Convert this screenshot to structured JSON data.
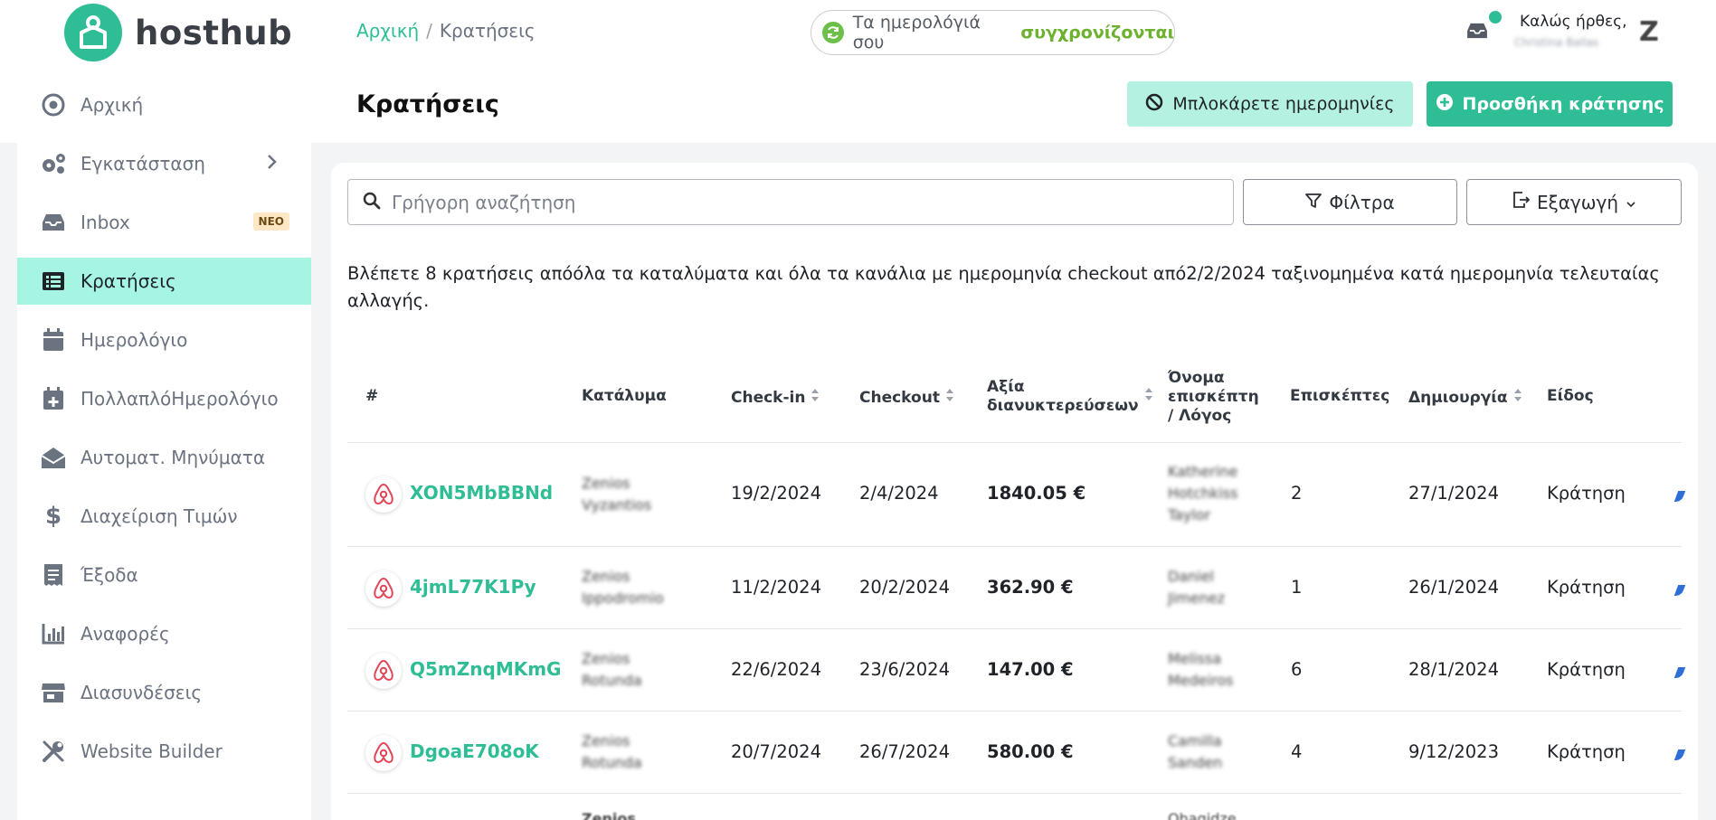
{
  "app": {
    "name": "hosthub"
  },
  "sidebar": {
    "items": [
      {
        "label": "Αρχική",
        "icon": "target-icon"
      },
      {
        "label": "Εγκατάσταση",
        "icon": "gears-icon"
      },
      {
        "label": "Inbox",
        "icon": "inbox-icon",
        "badge": "ΝΕΟ"
      },
      {
        "label": "Κρατήσεις",
        "icon": "list-icon",
        "active": true
      },
      {
        "label": "Ημερολόγιο",
        "icon": "calendar-icon"
      },
      {
        "label": "ΠολλαπλόΗμερολόγιο",
        "icon": "calendar-plus-icon"
      },
      {
        "label": "Αυτοματ. Μηνύματα",
        "icon": "envelope-open-icon"
      },
      {
        "label": "Διαχείριση Τιμών",
        "icon": "dollar-icon"
      },
      {
        "label": "Έξοδα",
        "icon": "receipt-icon"
      },
      {
        "label": "Αναφορές",
        "icon": "bar-chart-icon"
      },
      {
        "label": "Διασυνδέσεις",
        "icon": "store-icon"
      },
      {
        "label": "Website Builder",
        "icon": "tools-icon"
      }
    ]
  },
  "header": {
    "breadcrumb": {
      "home": "Αρχική",
      "separator": "/",
      "current": "Κρατήσεις"
    },
    "sync": {
      "text": "Τα ημερολόγιά σου",
      "strong": "συγχρονίζονται"
    },
    "user": {
      "greeting": "Καλώς ήρθες,",
      "name": "Christina Ballas"
    }
  },
  "page": {
    "title": "Κρατήσεις",
    "block_label": "Μπλοκάρετε ημερομηνίες",
    "add_label": "Προσθήκη κράτησης"
  },
  "toolbar": {
    "search_placeholder": "Γρήγορη αναζήτηση",
    "filter_label": "Φίλτρα",
    "export_label": "Εξαγωγή"
  },
  "summary": "Βλέπετε 8 κρατήσεις απόόλα τα καταλύματα και όλα τα κανάλια με ημερομηνία checkout από2/2/2024 ταξινομημένα κατά ημερομηνία τελευταίας αλλαγής.",
  "table": {
    "headers": {
      "num": "#",
      "property": "Κατάλυμα",
      "checkin": "Check-in",
      "checkout": "Checkout",
      "value_1": "Αξία",
      "value_2": "διανυκτερεύσεων",
      "guest_1": "Όνομα",
      "guest_2": "επισκέπτη",
      "guest_3": "/ Λόγος",
      "guests": "Επισκέπτες",
      "created": "Δημιουργία",
      "type": "Είδος"
    },
    "rows": [
      {
        "code": "XON5MbBBNd",
        "property": "Zenios Vyzantios",
        "checkin": "19/2/2024",
        "checkout": "2/4/2024",
        "value": "1840.05 €",
        "guest": "Katherine Hotchkiss Taylor",
        "guests": "2",
        "created": "27/1/2024",
        "type": "Κράτηση"
      },
      {
        "code": "4jmL77K1Py",
        "property": "Zenios Ippodromio",
        "checkin": "11/2/2024",
        "checkout": "20/2/2024",
        "value": "362.90 €",
        "guest": "Daniel Jimenez",
        "guests": "1",
        "created": "26/1/2024",
        "type": "Κράτηση"
      },
      {
        "code": "Q5mZnqMKmG",
        "property": "Zenios Rotunda",
        "checkin": "22/6/2024",
        "checkout": "23/6/2024",
        "value": "147.00 €",
        "guest": "Melissa Medeiros",
        "guests": "6",
        "created": "28/1/2024",
        "type": "Κράτηση"
      },
      {
        "code": "DgoaE708oK",
        "property": "Zenios Rotunda",
        "checkin": "20/7/2024",
        "checkout": "26/7/2024",
        "value": "580.00 €",
        "guest": "Camilla Sanden",
        "guests": "4",
        "created": "9/12/2023",
        "type": "Κράτηση"
      },
      {
        "property": "Zenios",
        "guest": "Ohagidze"
      }
    ]
  },
  "colors": {
    "brand": "#2fbd95",
    "active_bg": "#a6f5e2",
    "sync_green": "#6cb22e"
  }
}
